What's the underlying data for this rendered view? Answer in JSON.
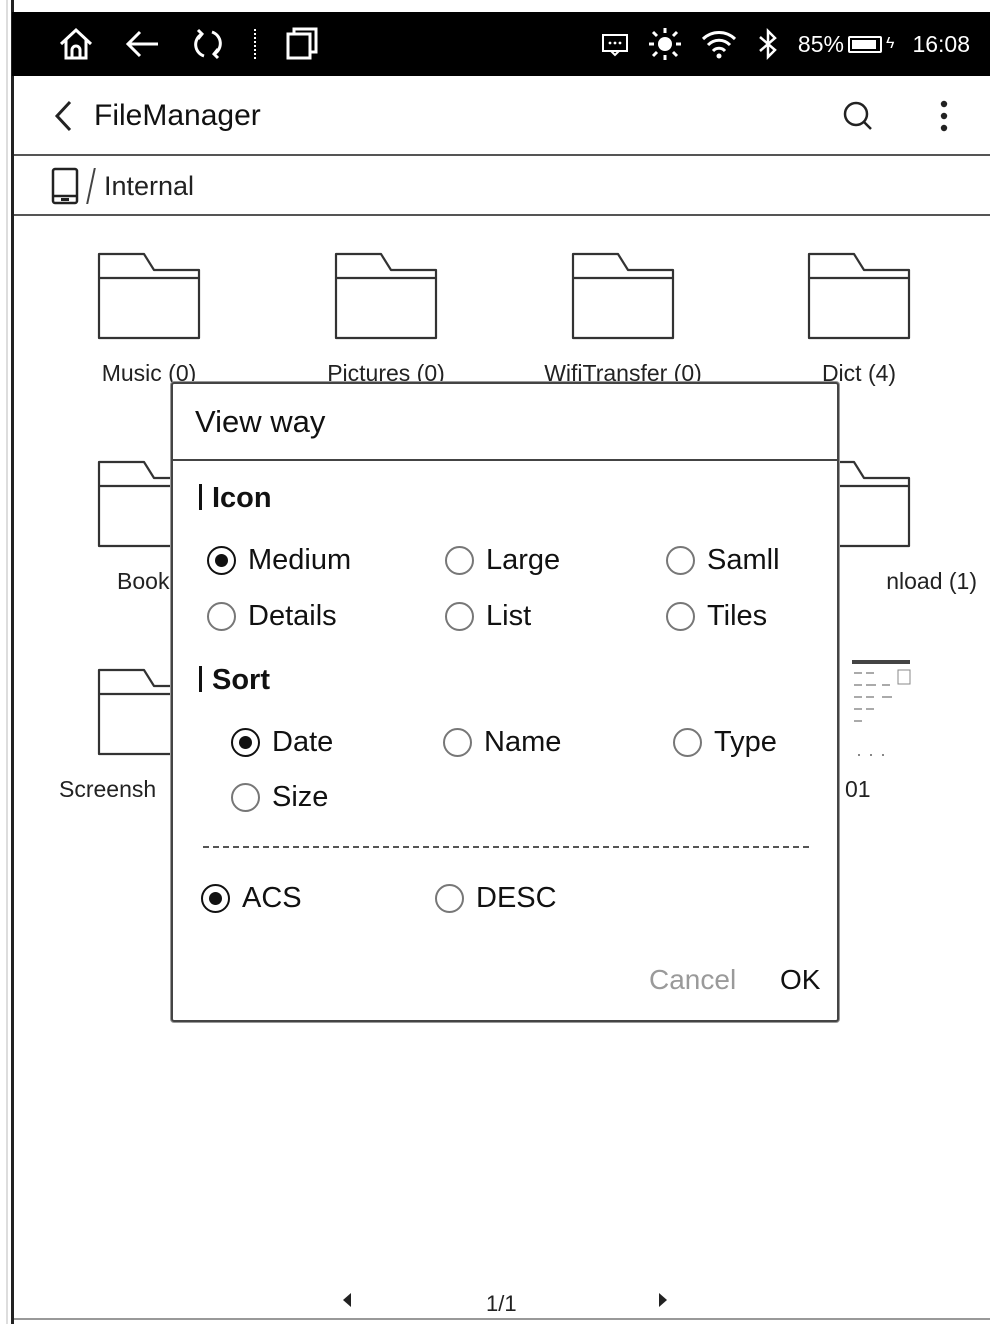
{
  "status_bar": {
    "battery_percent": "85%",
    "time": "16:08",
    "icons": [
      "home-icon",
      "back-arrow-icon",
      "refresh-icon",
      "window-icon",
      "message-icon",
      "brightness-icon",
      "wifi-icon",
      "bluetooth-icon",
      "battery-icon"
    ]
  },
  "app_bar": {
    "title": "FileManager",
    "icons": [
      "chevron-left-icon",
      "search-icon",
      "more-vertical-icon"
    ]
  },
  "breadcrumb": {
    "path": "Internal"
  },
  "folders": [
    {
      "label": "Music (0)"
    },
    {
      "label": "Pictures (0)"
    },
    {
      "label": "WifiTransfer (0)"
    },
    {
      "label": "Dict (4)"
    },
    {
      "label": "Books"
    },
    {
      "label": "nload (1)"
    },
    {
      "label": "Screensh"
    },
    {
      "label": "01"
    }
  ],
  "dialog": {
    "title": "View way",
    "icon_section": {
      "title": "Icon",
      "options": [
        "Medium",
        "Large",
        "Samll",
        "Details",
        "List",
        "Tiles"
      ],
      "selected": "Medium"
    },
    "sort_section": {
      "title": "Sort",
      "options": [
        "Date",
        "Name",
        "Type",
        "Size"
      ],
      "selected": "Date"
    },
    "order": {
      "options": [
        "ACS",
        "DESC"
      ],
      "selected": "ACS"
    },
    "cancel_label": "Cancel",
    "ok_label": "OK"
  },
  "pager": {
    "page": "1/1"
  }
}
